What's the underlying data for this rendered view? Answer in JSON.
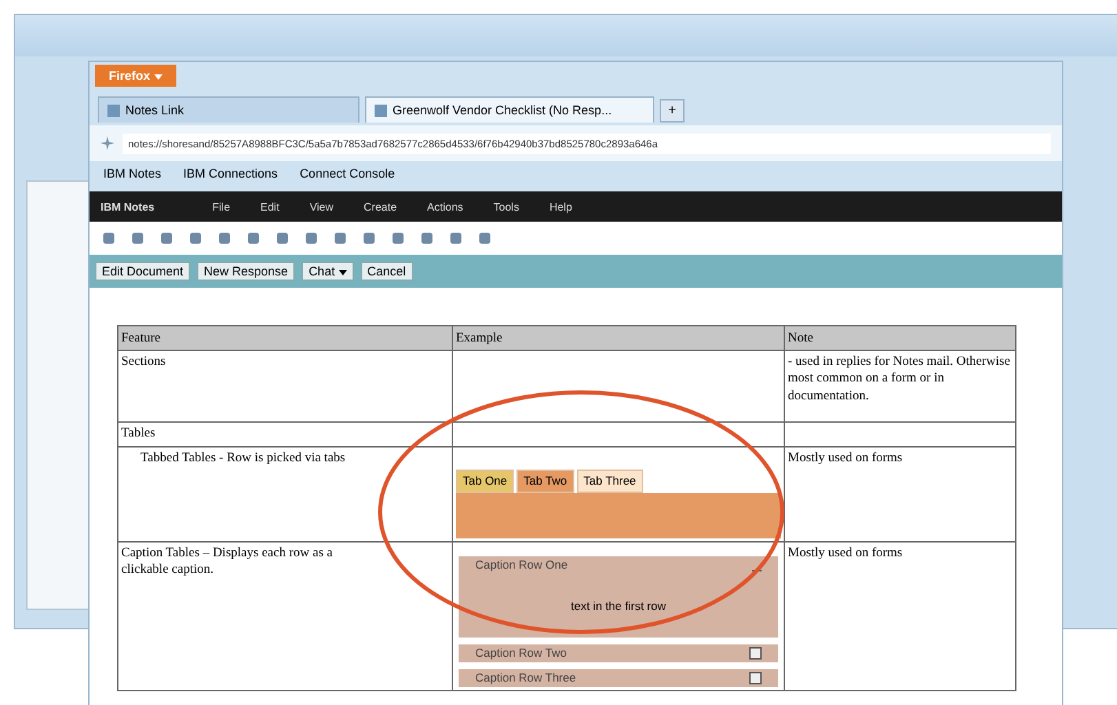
{
  "browser": {
    "menu_button": "Firefox",
    "tabs": [
      {
        "label": "Notes Link",
        "selected": false
      },
      {
        "label": "Greenwolf Vendor Checklist (No Resp...",
        "selected": true
      }
    ],
    "new_tab": "+",
    "address": "notes://shoresand/85257A8988BFC3C/5a5a7b7853ad7682577c2865d4533/6f76b42940b37bd8525780c2893a646a",
    "bookmarks": [
      "IBM Notes",
      "IBM Connections",
      "Connect Console"
    ]
  },
  "app": {
    "title": "IBM Notes",
    "menu": [
      "File",
      "Edit",
      "View",
      "Create",
      "Actions",
      "Tools",
      "Help"
    ],
    "actions": [
      {
        "label": "Edit Document",
        "kind": "button"
      },
      {
        "label": "New Response",
        "kind": "button"
      },
      {
        "label": "Chat",
        "kind": "dropdown"
      },
      {
        "label": "Cancel",
        "kind": "button"
      }
    ]
  },
  "table": {
    "columns": [
      "Feature",
      "Example",
      "Note"
    ],
    "rows": [
      {
        "kind": "plain",
        "feature": "Sections",
        "note": "- used in replies for Notes mail. Otherwise most common on a form or in documentation."
      },
      {
        "kind": "plain",
        "feature": "Tables",
        "note": ""
      },
      {
        "kind": "tabbed",
        "feature": "Tabbed Tables - Row is picked via tabs",
        "note": "Mostly used on forms",
        "tabs": [
          {
            "label": "Tab One",
            "selected": false
          },
          {
            "label": "Tab Two",
            "selected": true
          },
          {
            "label": "Tab Three",
            "selected": false
          }
        ]
      },
      {
        "kind": "caption",
        "feature": "Caption Tables – Displays each row as a clickable caption.",
        "note": "Mostly used on forms",
        "captions": [
          {
            "label": "Caption Row One",
            "expanded": true,
            "body": "text in the first row"
          },
          {
            "label": "Caption Row Two",
            "expanded": false
          },
          {
            "label": "Caption Row Three",
            "expanded": false
          }
        ]
      }
    ]
  }
}
